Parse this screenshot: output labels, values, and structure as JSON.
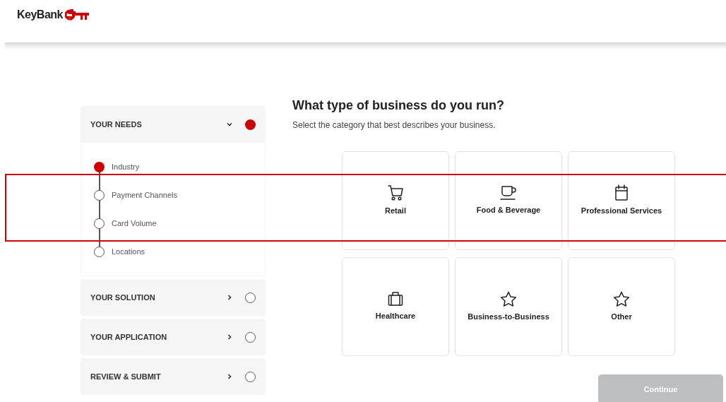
{
  "header": {
    "logo_text": "KeyBank"
  },
  "sidebar": {
    "sections": [
      {
        "title": "YOUR NEEDS",
        "expanded": true,
        "current": true,
        "steps": [
          {
            "label": "Industry",
            "selected": true
          },
          {
            "label": "Payment Channels",
            "selected": false
          },
          {
            "label": "Card Volume",
            "selected": false
          },
          {
            "label": "Locations",
            "selected": false
          }
        ]
      },
      {
        "title": "YOUR SOLUTION",
        "expanded": false,
        "current": false
      },
      {
        "title": "YOUR APPLICATION",
        "expanded": false,
        "current": false
      },
      {
        "title": "REVIEW & SUBMIT",
        "expanded": false,
        "current": false
      }
    ]
  },
  "main": {
    "title": "What type of business do you run?",
    "subtitle": "Select the category that best describes your business.",
    "categories": [
      {
        "label": "Retail",
        "selected": false
      },
      {
        "label": "Food & Beverage",
        "selected": false
      },
      {
        "label": "Professional Services",
        "selected": false
      },
      {
        "label": "Healthcare",
        "selected": false
      },
      {
        "label": "Business-to-Business",
        "selected": false
      },
      {
        "label": "Other",
        "selected": false
      }
    ]
  },
  "continue_button": {
    "label": "Continue",
    "disabled": true
  }
}
